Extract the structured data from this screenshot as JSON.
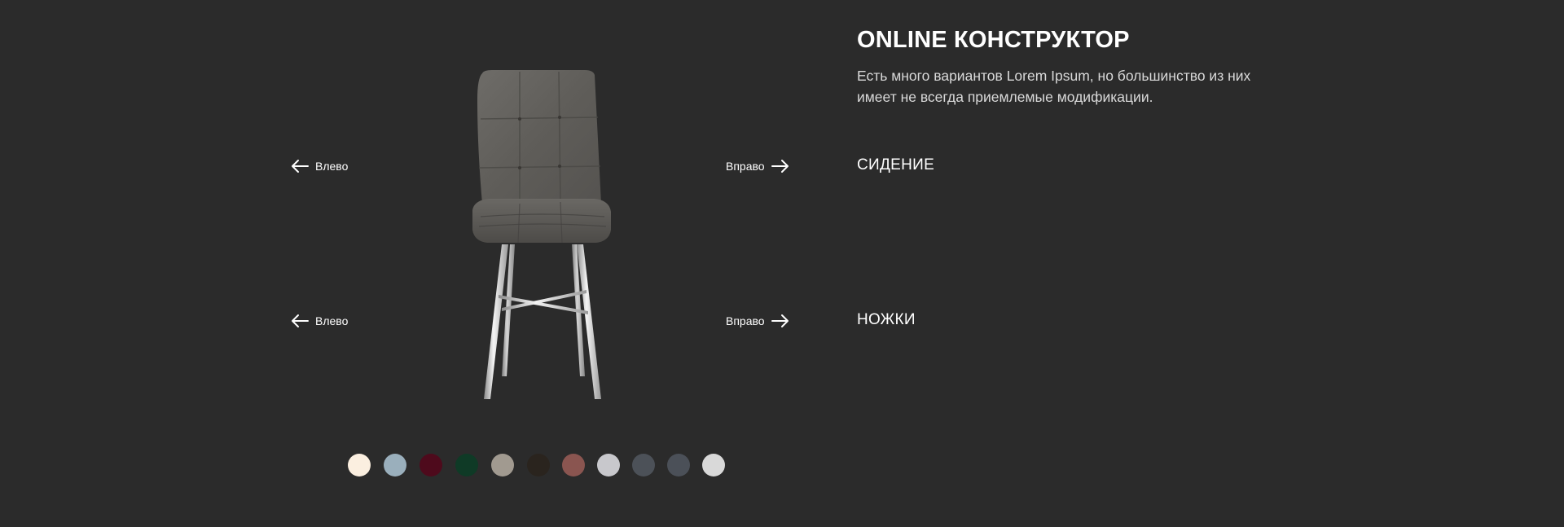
{
  "constructor": {
    "title": "ONLINE КОНСТРУКТОР",
    "description": "Есть много вариантов Lorem Ipsum, но большинство из них имеет не всегда приемлемые модификации."
  },
  "seat": {
    "label": "СИДЕНИЕ",
    "left_label": "Влево",
    "right_label": "Вправо"
  },
  "legs": {
    "label": "НОЖКИ",
    "left_label": "Влево",
    "right_label": "Вправо"
  },
  "icons": {
    "left": "arrow-left-icon",
    "right": "arrow-right-icon"
  },
  "swatches": [
    {
      "color": "#fbefe0"
    },
    {
      "color": "#9aafbc"
    },
    {
      "color": "#4e0a1c"
    },
    {
      "color": "#0f3a26"
    },
    {
      "color": "#a19a90"
    },
    {
      "color": "#2a241e"
    },
    {
      "color": "#8a5550"
    },
    {
      "color": "#c8c8cc"
    },
    {
      "color": "#4c5158"
    },
    {
      "color": "#4b5058"
    },
    {
      "color": "#d9d9d9"
    }
  ]
}
